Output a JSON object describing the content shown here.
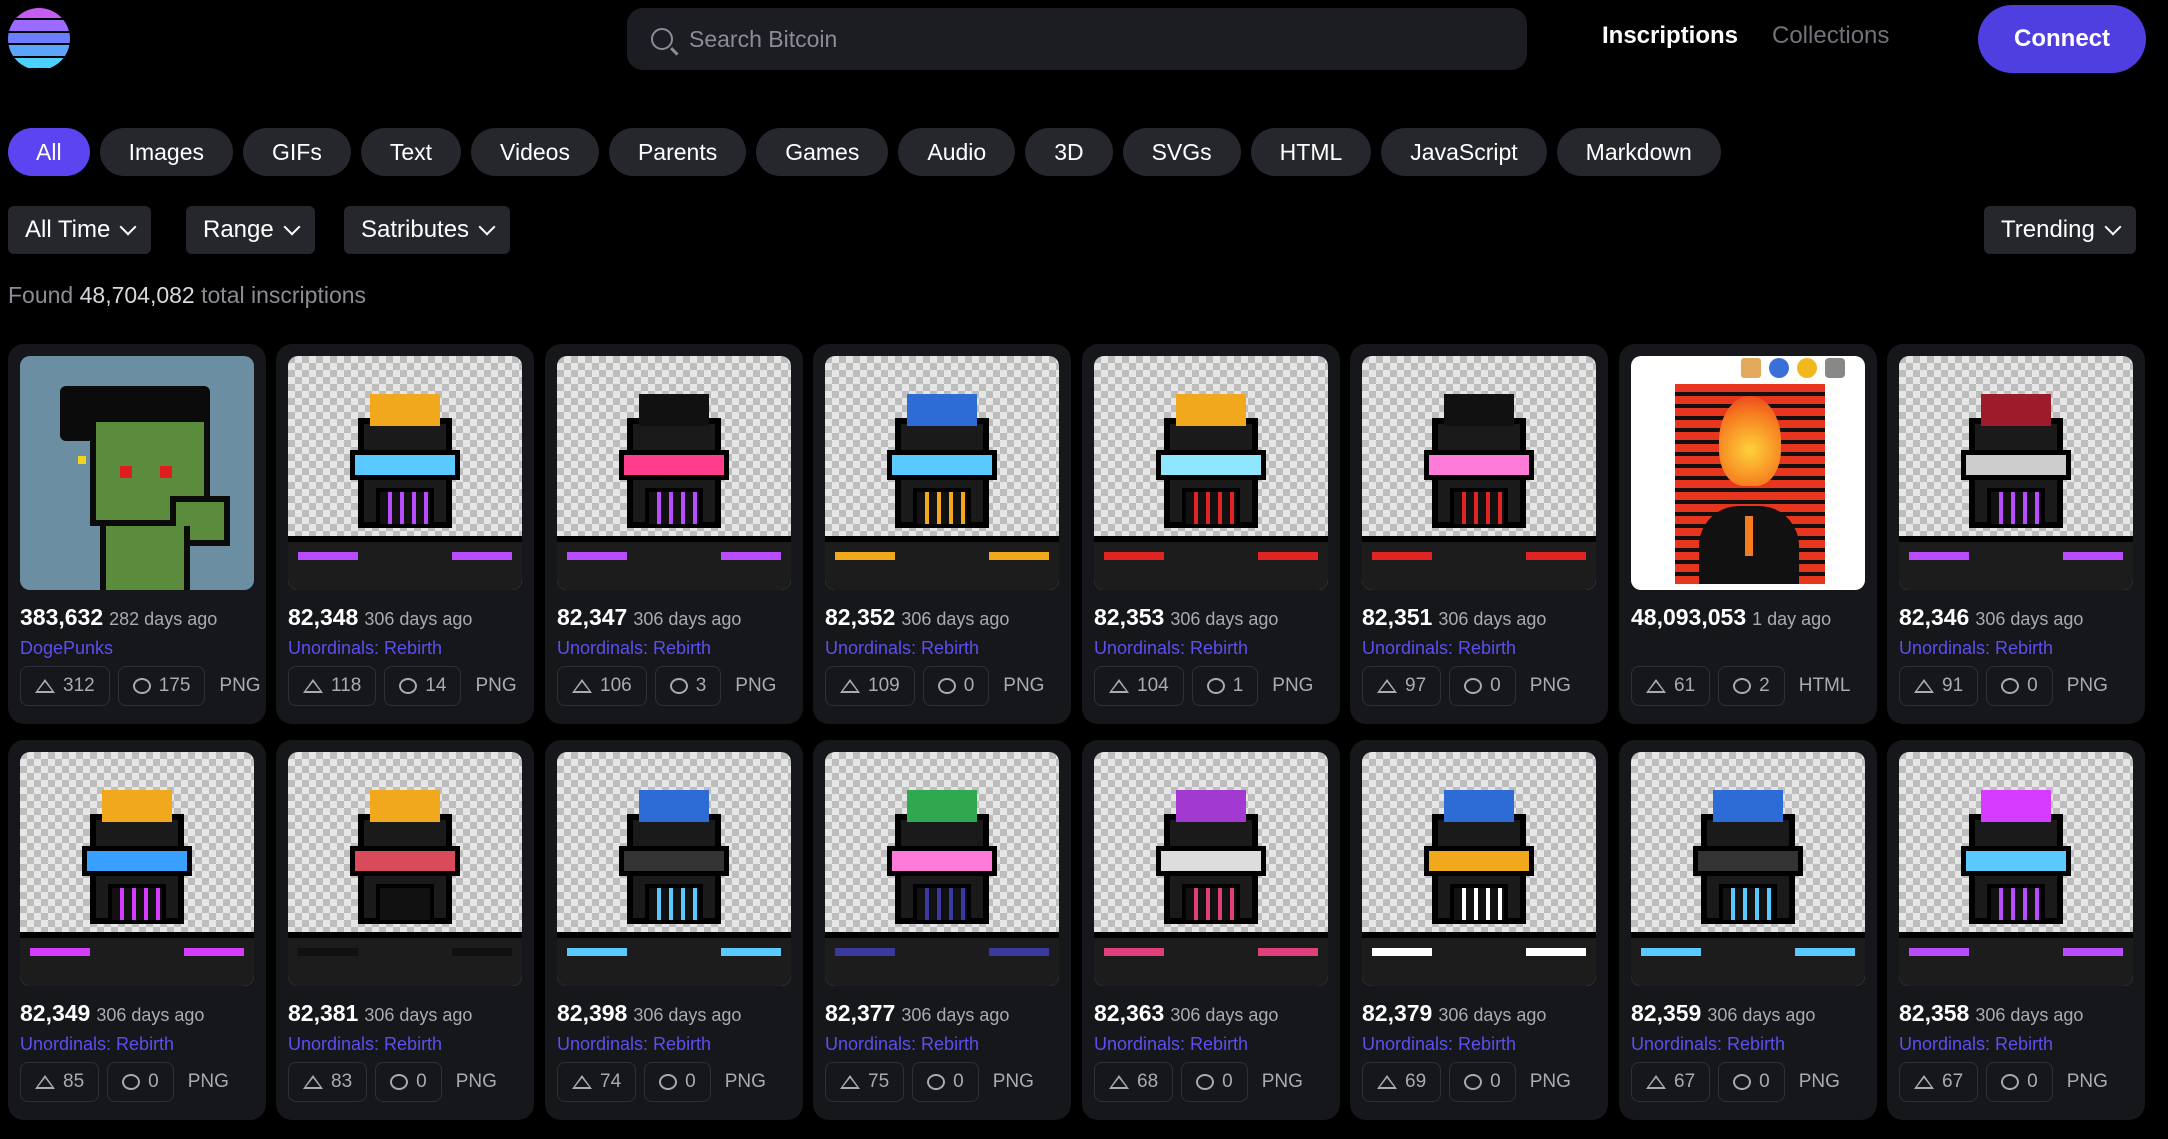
{
  "header": {
    "search_placeholder": "Search Bitcoin",
    "nav": [
      {
        "label": "Inscriptions"
      },
      {
        "label": "Collections"
      }
    ],
    "connect_label": "Connect",
    "logo_colors": [
      "#c65cf2",
      "#9b6bff",
      "#6e7dff",
      "#5aa6ff",
      "#4cd1ff"
    ]
  },
  "filters": {
    "chips": [
      "All",
      "Images",
      "GIFs",
      "Text",
      "Videos",
      "Parents",
      "Games",
      "Audio",
      "3D",
      "SVGs",
      "HTML",
      "JavaScript",
      "Markdown"
    ],
    "active": "All",
    "dropdowns": {
      "time": "All Time",
      "range": "Range",
      "satributes": "Satributes",
      "sort": "Trending"
    }
  },
  "found": {
    "prefix": "Found",
    "count": "48,704,082",
    "suffix": "total inscriptions"
  },
  "colors": {
    "accent": "#5a45f0",
    "collection_link": "#5b4ff0",
    "card_bg": "#15171b"
  },
  "cards": [
    {
      "number": "383,632",
      "ago": "282 days ago",
      "collection": "DogePunks",
      "upvotes": "312",
      "comments": "175",
      "type": "PNG",
      "art": "doge"
    },
    {
      "number": "82,348",
      "ago": "306 days ago",
      "collection": "Unordinals: Rebirth",
      "upvotes": "118",
      "comments": "14",
      "type": "PNG",
      "art": "robot",
      "hair": "#f2a81d",
      "visor": "#59c9ff",
      "accent": "#b84dff"
    },
    {
      "number": "82,347",
      "ago": "306 days ago",
      "collection": "Unordinals: Rebirth",
      "upvotes": "106",
      "comments": "3",
      "type": "PNG",
      "art": "robot",
      "hair": "#111111",
      "visor": "#ff3d8c",
      "accent": "#b84dff"
    },
    {
      "number": "82,352",
      "ago": "306 days ago",
      "collection": "Unordinals: Rebirth",
      "upvotes": "109",
      "comments": "0",
      "type": "PNG",
      "art": "robot",
      "hair": "#2d6bd6",
      "visor": "#59c9ff",
      "accent": "#f2a81d"
    },
    {
      "number": "82,353",
      "ago": "306 days ago",
      "collection": "Unordinals: Rebirth",
      "upvotes": "104",
      "comments": "1",
      "type": "PNG",
      "art": "robot",
      "hair": "#f2a81d",
      "visor": "#8fe6ff",
      "accent": "#e02424"
    },
    {
      "number": "82,351",
      "ago": "306 days ago",
      "collection": "Unordinals: Rebirth",
      "upvotes": "97",
      "comments": "0",
      "type": "PNG",
      "art": "robot",
      "hair": "#111111",
      "visor": "#ff7ad9",
      "accent": "#e02424"
    },
    {
      "number": "48,093,053",
      "ago": "1 day ago",
      "collection": "",
      "upvotes": "61",
      "comments": "2",
      "type": "HTML",
      "art": "fire"
    },
    {
      "number": "82,346",
      "ago": "306 days ago",
      "collection": "Unordinals: Rebirth",
      "upvotes": "91",
      "comments": "0",
      "type": "PNG",
      "art": "robot",
      "hair": "#9e1b2b",
      "visor": "#cccccc",
      "accent": "#b84dff"
    },
    {
      "number": "82,349",
      "ago": "306 days ago",
      "collection": "Unordinals: Rebirth",
      "upvotes": "85",
      "comments": "0",
      "type": "PNG",
      "art": "robot",
      "hair": "#f2a81d",
      "visor": "#3aa0ff",
      "accent": "#d63cff"
    },
    {
      "number": "82,381",
      "ago": "306 days ago",
      "collection": "Unordinals: Rebirth",
      "upvotes": "83",
      "comments": "0",
      "type": "PNG",
      "art": "robot",
      "hair": "#f2a81d",
      "visor": "#d94b5a",
      "accent": "#111111"
    },
    {
      "number": "82,398",
      "ago": "306 days ago",
      "collection": "Unordinals: Rebirth",
      "upvotes": "74",
      "comments": "0",
      "type": "PNG",
      "art": "robot",
      "hair": "#2d6bd6",
      "visor": "#333333",
      "accent": "#59c9ff"
    },
    {
      "number": "82,377",
      "ago": "306 days ago",
      "collection": "Unordinals: Rebirth",
      "upvotes": "75",
      "comments": "0",
      "type": "PNG",
      "art": "robot",
      "hair": "#2fa84f",
      "visor": "#ff7ad9",
      "accent": "#3a3a9e"
    },
    {
      "number": "82,363",
      "ago": "306 days ago",
      "collection": "Unordinals: Rebirth",
      "upvotes": "68",
      "comments": "0",
      "type": "PNG",
      "art": "robot",
      "hair": "#a23ad1",
      "visor": "#dddddd",
      "accent": "#e0407a"
    },
    {
      "number": "82,379",
      "ago": "306 days ago",
      "collection": "Unordinals: Rebirth",
      "upvotes": "69",
      "comments": "0",
      "type": "PNG",
      "art": "robot",
      "hair": "#2d6bd6",
      "visor": "#f2a81d",
      "accent": "#ffffff"
    },
    {
      "number": "82,359",
      "ago": "306 days ago",
      "collection": "Unordinals: Rebirth",
      "upvotes": "67",
      "comments": "0",
      "type": "PNG",
      "art": "robot",
      "hair": "#2d6bd6",
      "visor": "#333333",
      "accent": "#59c9ff"
    },
    {
      "number": "82,358",
      "ago": "306 days ago",
      "collection": "Unordinals: Rebirth",
      "upvotes": "67",
      "comments": "0",
      "type": "PNG",
      "art": "robot",
      "hair": "#d63cff",
      "visor": "#59c9ff",
      "accent": "#b84dff"
    }
  ]
}
